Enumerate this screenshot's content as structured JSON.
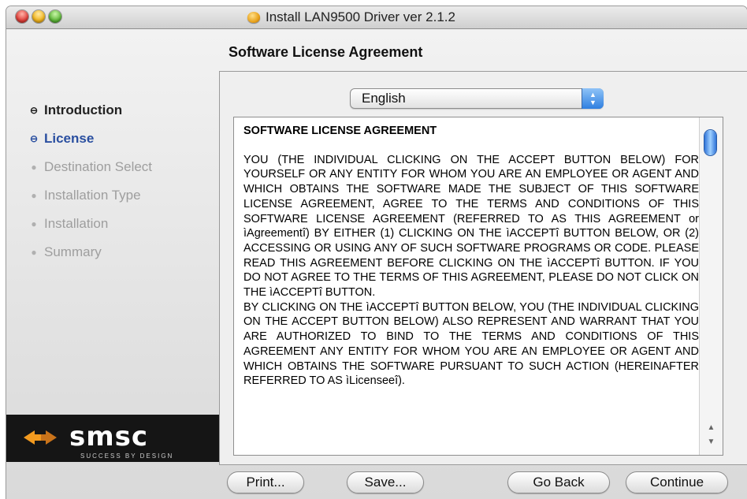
{
  "window": {
    "title": "Install LAN9500 Driver ver 2.1.2",
    "title_icon": "package-icon"
  },
  "pane_title": "Software License Agreement",
  "steps": [
    {
      "label": "Introduction",
      "state": "done"
    },
    {
      "label": "License",
      "state": "current"
    },
    {
      "label": "Destination Select",
      "state": "pending"
    },
    {
      "label": "Installation Type",
      "state": "pending"
    },
    {
      "label": "Installation",
      "state": "pending"
    },
    {
      "label": "Summary",
      "state": "pending"
    }
  ],
  "logo": {
    "text": "smsc",
    "tagline": "SUCCESS BY DESIGN",
    "accent": "#f29a1f"
  },
  "language": {
    "selected": "English"
  },
  "license": {
    "heading": "SOFTWARE LICENSE AGREEMENT",
    "para1": "YOU (THE INDIVIDUAL CLICKING ON THE ACCEPT BUTTON BELOW) FOR YOURSELF OR ANY ENTITY FOR WHOM YOU ARE AN EMPLOYEE OR AGENT AND WHICH OBTAINS THE SOFTWARE MADE THE SUBJECT OF THIS SOFTWARE LICENSE AGREEMENT, AGREE TO THE TERMS AND CONDITIONS OF THIS SOFTWARE LICENSE AGREEMENT (REFERRED TO AS THIS AGREEMENT or ìAgreementî) BY EITHER (1) CLICKING ON THE ìACCEPTî BUTTON BELOW, OR (2) ACCESSING OR USING ANY OF SUCH SOFTWARE PROGRAMS OR CODE. PLEASE READ THIS AGREEMENT BEFORE CLICKING ON THE ìACCEPTî BUTTON. IF YOU DO NOT AGREE TO THE TERMS OF THIS AGREEMENT, PLEASE DO NOT CLICK ON THE ìACCEPTî BUTTON.",
    "para2": "BY CLICKING ON THE ìACCEPTî BUTTON BELOW, YOU (THE INDIVIDUAL CLICKING ON THE ACCEPT BUTTON BELOW) ALSO REPRESENT AND WARRANT THAT YOU ARE AUTHORIZED TO BIND TO THE TERMS AND CONDITIONS OF THIS AGREEMENT ANY ENTITY FOR WHOM YOU ARE AN EMPLOYEE OR AGENT AND WHICH OBTAINS THE SOFTWARE PURSUANT TO SUCH ACTION (HEREINAFTER REFERRED TO AS ìLicenseeî)."
  },
  "buttons": {
    "print": "Print...",
    "save": "Save...",
    "go_back": "Go Back",
    "continue": "Continue"
  },
  "colors": {
    "current_step": "#2a4fa0",
    "scroll_accent": "#2f73d8"
  }
}
